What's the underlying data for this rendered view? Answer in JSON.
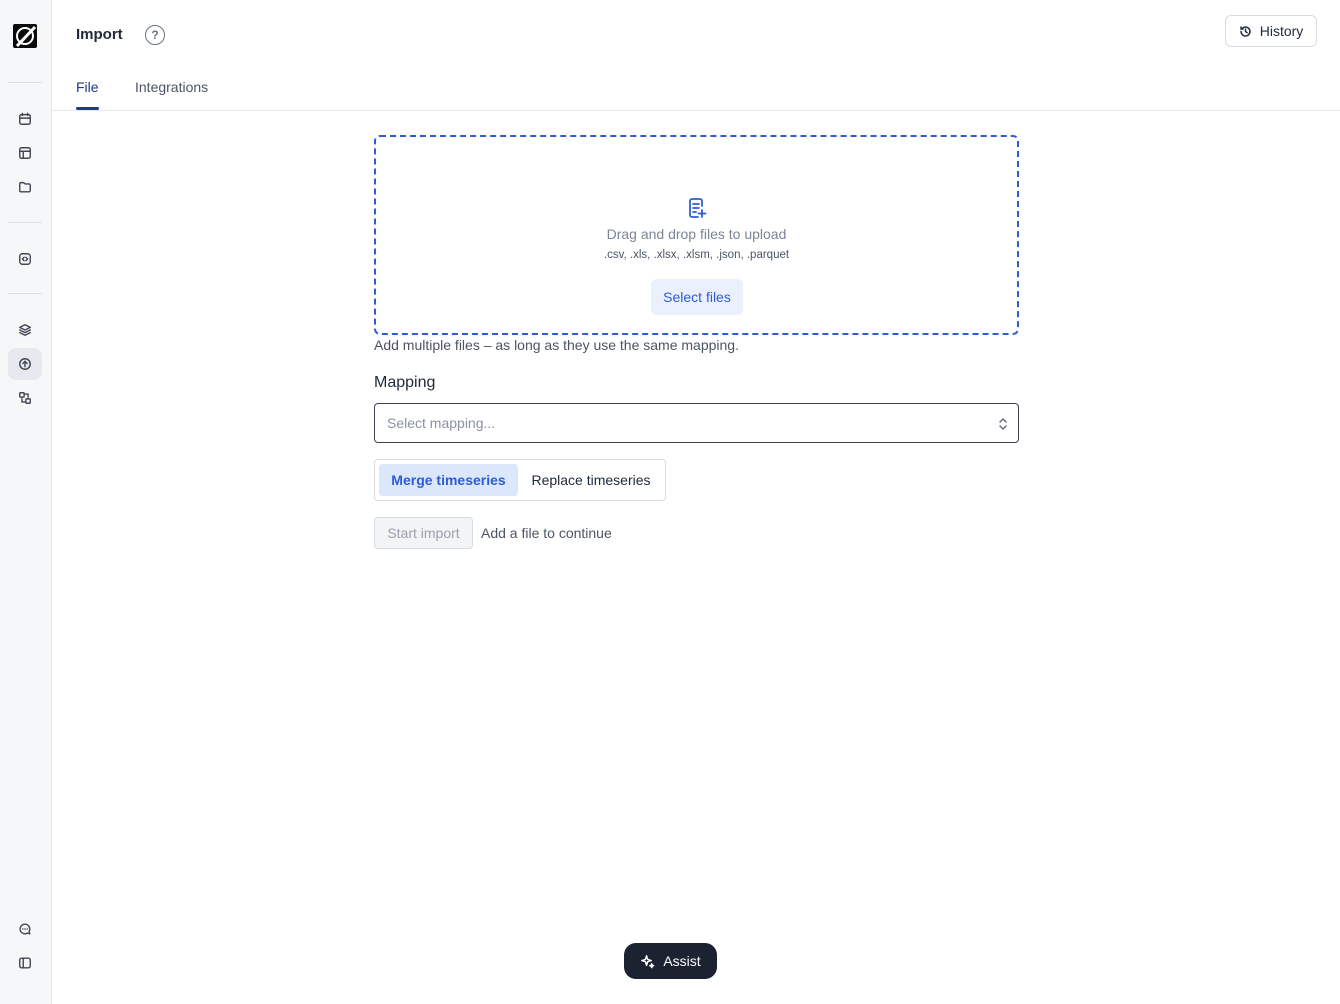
{
  "header": {
    "title": "Import",
    "help_glyph": "?",
    "history_label": "History"
  },
  "tabs": [
    {
      "label": "File",
      "active": true
    },
    {
      "label": "Integrations",
      "active": false
    }
  ],
  "sidebar": {
    "items": [
      {
        "icon": "calendar-icon"
      },
      {
        "icon": "table-icon"
      },
      {
        "icon": "folder-icon"
      },
      {
        "icon": "code-square-icon"
      },
      {
        "icon": "layers-icon"
      },
      {
        "icon": "upload-icon",
        "active": true
      },
      {
        "icon": "shapes-icon"
      },
      {
        "icon": "chat-icon"
      },
      {
        "icon": "sidebar-toggle-icon"
      }
    ]
  },
  "upload": {
    "prompt": "Drag and drop files to upload",
    "formats": ".csv, .xls, .xlsx, .xlsm, .json, .parquet",
    "select_label": "Select files",
    "hint": "Add multiple files – as long as they use the same mapping."
  },
  "mapping": {
    "label": "Mapping",
    "placeholder": "Select mapping..."
  },
  "mode": {
    "options": [
      "Merge timeseries",
      "Replace timeseries"
    ],
    "selected": "Merge timeseries"
  },
  "actions": {
    "start_label": "Start import",
    "status_text": "Add a file to continue"
  },
  "assist": {
    "label": "Assist"
  },
  "colors": {
    "accent": "#2f5bd6",
    "tab_active": "#1e3a8a",
    "assist_bg": "#1c2330"
  }
}
